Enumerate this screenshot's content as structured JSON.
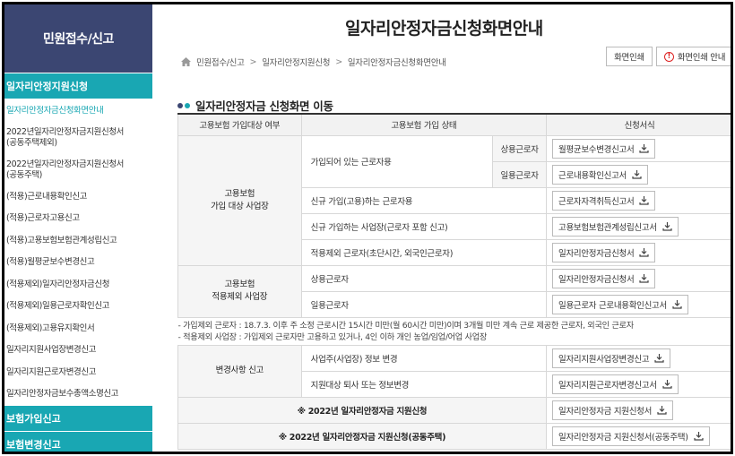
{
  "sidebar": {
    "title": "민원접수/신고",
    "categories": [
      {
        "label": "일자리안정지원신청"
      },
      {
        "label": "보험가입신고"
      },
      {
        "label": "보험변경신고"
      }
    ],
    "items": [
      {
        "label": "일자리안정자금신청화면안내"
      },
      {
        "label": "2022년일자리안정자금지원신청서"
      },
      {
        "label": "(공동주택제외)"
      },
      {
        "label": "2022년일자리안정자금지원신청서"
      },
      {
        "label": "(공동주택)"
      },
      {
        "label": "(적용)근로내용확인신고"
      },
      {
        "label": "(적용)근로자고용신고"
      },
      {
        "label": "(적용)고용보험보험관계성립신고"
      },
      {
        "label": "(적용)월평균보수변경신고"
      },
      {
        "label": "(적용제외)일자리안정자금신청"
      },
      {
        "label": "(적용제외)일용근로자확인신고"
      },
      {
        "label": "(적용제외)고용유지확인서"
      },
      {
        "label": "일자리지원사업장변경신고"
      },
      {
        "label": "일자리지원근로자변경신고"
      },
      {
        "label": "일자리안정자금보수총액소명신고"
      }
    ]
  },
  "page": {
    "title": "일자리안정자금신청화면안내",
    "breadcrumb": [
      "민원접수/신고",
      "일자리안정지원신청",
      "일자리안정자금신청화면안내"
    ],
    "print_label": "화면인쇄",
    "print_guide_label": "화면인쇄 안내",
    "section_title": "일자리안정자금 신청화면 이동"
  },
  "table": {
    "headers": [
      "고용보험 가입대상 여부",
      "고용보험 가입 상태",
      "신청서식"
    ],
    "group1": "고용보험\n가입 대상 사업장",
    "group2": "고용보험\n적용제외 사업장",
    "group3": "변경사항 신고",
    "rows": {
      "r1_status": "가입되어 있는 근로자용",
      "r1a_sub": "상용근로자",
      "r1a_form": "월평균보수변경신고서",
      "r1b_sub": "일용근로자",
      "r1b_form": "근로내용확인신고서",
      "r2_status": "신규 가입(고용)하는 근로자용",
      "r2_form": "근로자자격취득신고서",
      "r3_status": "신규 가입하는 사업장(근로자 포함 신고)",
      "r3_form": "고용보험보험관계성립신고서",
      "r4_status": "적용제외 근로자(초단시간, 외국인근로자)",
      "r4_form": "일자리안정자금신청서",
      "r5_status": "상용근로자",
      "r5_form": "일자리안정자금신청서",
      "r6_status": "일용근로자",
      "r6_form": "일용근로자 근로내용확인신고서",
      "r7_status": "사업주(사업장) 정보 변경",
      "r7_form": "일자리지원사업장변경신고",
      "r8_status": "지원대상 퇴사 또는 정보변경",
      "r8_form": "일자리지원근로자변경신고서",
      "r9_center": "※ 2022년 일자리안정자금 지원신청",
      "r9_form": "일자리안정자금 지원신청서",
      "r10_center": "※ 2022년 일자리안정자금 지원신청(공동주택)",
      "r10_form": "일자리안정자금 지원신청서(공동주택)"
    },
    "note1": "- 가입제외 근로자 : 18.7.3. 이후 주 소정 근로시간 15시간 미만(월 60시간 미만)이며 3개월 미만 계속 근로 제공한 근로자, 외국인 근로자",
    "note2": "- 적용제외 사업장 : 가입제외 근로자만 고용하고 있거나, 4인 이하 개인 농업/임업/어업 사업장"
  },
  "colors": {
    "navy": "#3b4672",
    "teal": "#19a7b3"
  },
  "icons": [
    "home-icon",
    "warning-icon",
    "download-icon"
  ]
}
